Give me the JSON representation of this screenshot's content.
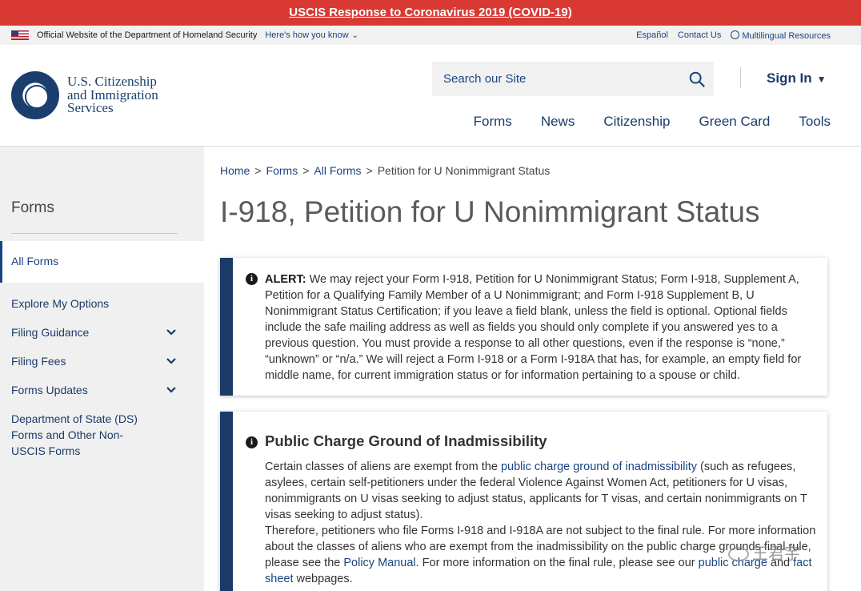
{
  "covid_banner": {
    "text": "USCIS Response to Coronavirus 2019 (COVID-19)"
  },
  "gov_banner": {
    "official_text": "Official Website of the Department of Homeland Security",
    "how_you_know": "Here's how you know",
    "links": [
      "Español",
      "Contact Us",
      "Multilingual Resources"
    ]
  },
  "header": {
    "agency_lines": [
      "U.S. Citizenship",
      "and Immigration",
      "Services"
    ],
    "search_placeholder": "Search our Site",
    "sign_in": "Sign In",
    "nav": [
      "Forms",
      "News",
      "Citizenship",
      "Green Card",
      "Tools"
    ]
  },
  "sidebar": {
    "title": "Forms",
    "active_item": "All Forms",
    "items": [
      {
        "label": "Explore My Options",
        "expandable": false
      },
      {
        "label": "Filing Guidance",
        "expandable": true
      },
      {
        "label": "Filing Fees",
        "expandable": true
      },
      {
        "label": "Forms Updates",
        "expandable": true
      }
    ],
    "ds_item_lines": [
      "Department of State (DS)",
      "Forms and Other Non-",
      "USCIS Forms"
    ]
  },
  "breadcrumb": {
    "items": [
      "Home",
      "Forms",
      "All Forms"
    ],
    "current": "Petition for U Nonimmigrant Status",
    "separator": ">"
  },
  "page_title": "I-918, Petition for U Nonimmigrant Status",
  "alert": {
    "label": "ALERT:",
    "text": " We may reject your Form I-918, Petition for U Nonimmigrant Status; Form I-918, Supplement A, Petition for a Qualifying Family Member of a U Nonimmigrant; and Form I-918 Supplement B, U Nonimmigrant Status Certification; if you leave a field blank, unless the field is optional. Optional fields include the safe mailing address as well as fields you should only complete if you answered yes to a previous question. You must provide a response to all other questions, even if the response is “none,” “unknown” or “n/a.”  We will reject a Form I-918 or a Form I-918A that has, for example, an empty field for middle name, for current immigration status or for information pertaining to a spouse or child."
  },
  "public_charge": {
    "title": "Public Charge Ground of Inadmissibility",
    "p1_before": "Certain classes of aliens are exempt from the ",
    "p1_link": "public charge ground of inadmissibility",
    "p1_after": " (such as refugees, asylees, certain self-petitioners under the federal Violence Against Women Act, petitioners for U visas, nonimmigrants on U visas seeking to adjust status, applicants for T visas, and certain nonimmigrants on T visas seeking to adjust status).",
    "p2_before": "Therefore, petitioners who file Forms I-918 and I-918A are not subject to the final rule. For more information about the classes of aliens who are exempt from the inadmissibility on the public charge grounds final rule, please see the ",
    "p2_link1": "Policy Manual",
    "p2_mid": ". For more information on the final rule, please see our ",
    "p2_link2": "public charge",
    "p2_and": " and ",
    "p2_link3": "fact sheet",
    "p2_after": " webpages."
  },
  "watermark": "王君宇",
  "colors": {
    "banner_red": "#d83933",
    "navy": "#1b3a68",
    "link_blue": "#1a4480",
    "sidebar_bg": "#f0f0f0"
  },
  "icons": [
    "us-flag-icon",
    "chevron-down-icon",
    "globe-icon",
    "dhs-seal-logo",
    "search-icon",
    "caret-down-icon",
    "info-icon"
  ]
}
